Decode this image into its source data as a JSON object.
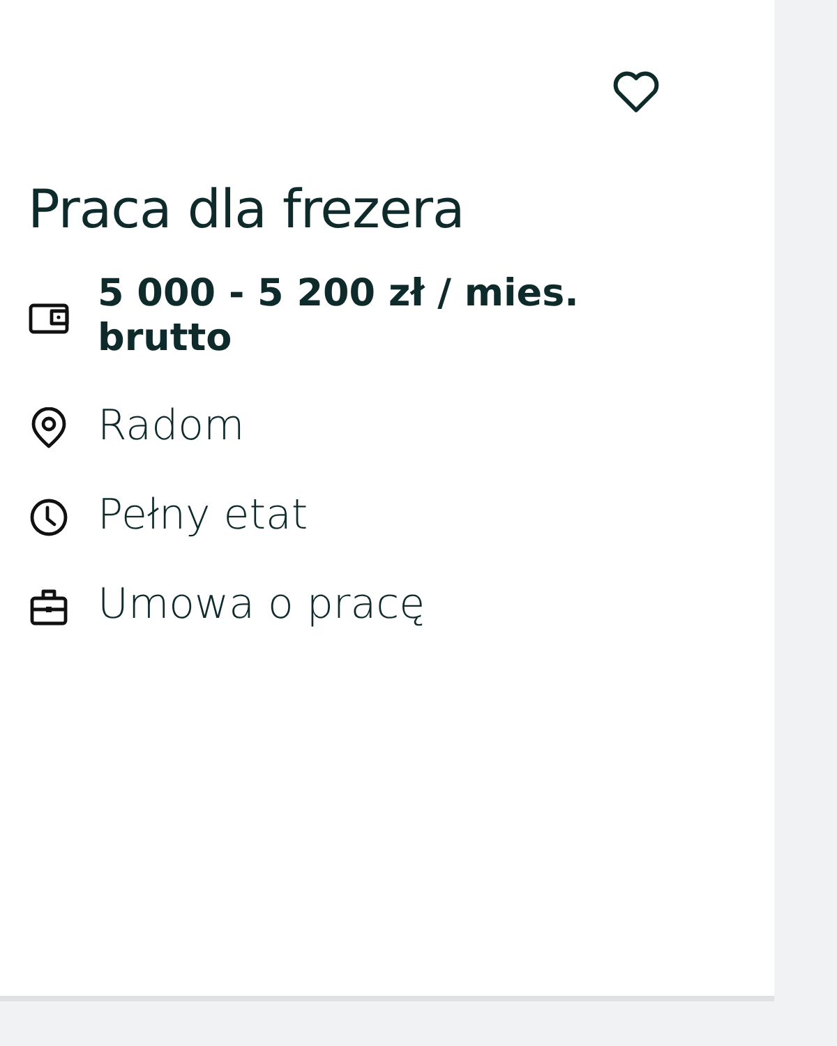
{
  "job": {
    "title": "Praca dla frezera",
    "details": [
      {
        "kind": "salary",
        "text": "5 000 - 5 200 zł / mies. brutto"
      },
      {
        "kind": "location",
        "text": "Radom"
      },
      {
        "kind": "worktime",
        "text": "Pełny etat"
      },
      {
        "kind": "contract",
        "text": "Umowa o pracę"
      }
    ]
  }
}
